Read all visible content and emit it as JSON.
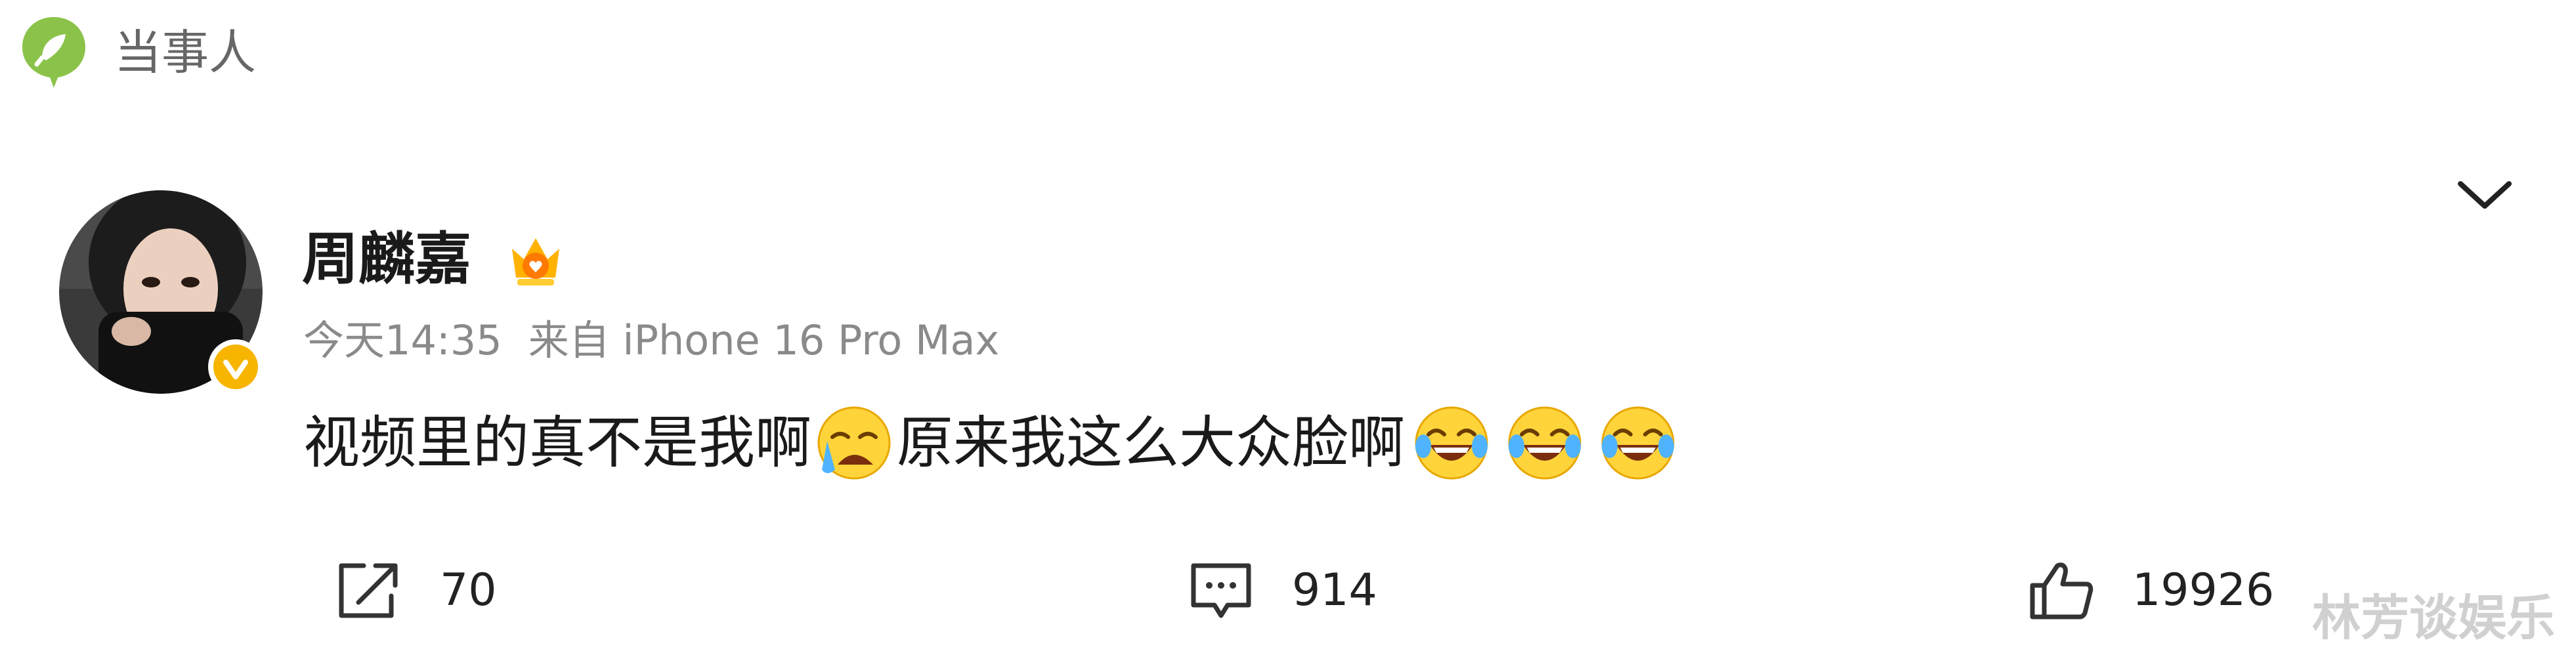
{
  "topic": {
    "label": "当事人",
    "icon": "topic-chat-bubble-icon",
    "icon_color": "#8bc34a"
  },
  "post": {
    "author": {
      "name": "周麟嘉",
      "avatar_icon": "user-avatar",
      "verified_badge_icon": "verified-v-icon",
      "verified_color": "#f7b500",
      "member_icon": "member-crown-icon"
    },
    "meta": {
      "time": "今天14:35",
      "source": "来自 iPhone 16 Pro Max"
    },
    "content": {
      "text_1": "视频里的真不是我啊",
      "emoji_1": "crying-emoji",
      "text_2": "原来我这么大众脸啊",
      "emoji_laugh": "laughing-tears-emoji"
    },
    "collapse_icon": "chevron-down-icon"
  },
  "actions": {
    "repost": {
      "icon": "repost-icon",
      "count": "70"
    },
    "comment": {
      "icon": "comment-icon",
      "count": "914"
    },
    "like": {
      "icon": "thumbs-up-icon",
      "count": "19926"
    }
  },
  "watermark": "林芳谈娱乐"
}
